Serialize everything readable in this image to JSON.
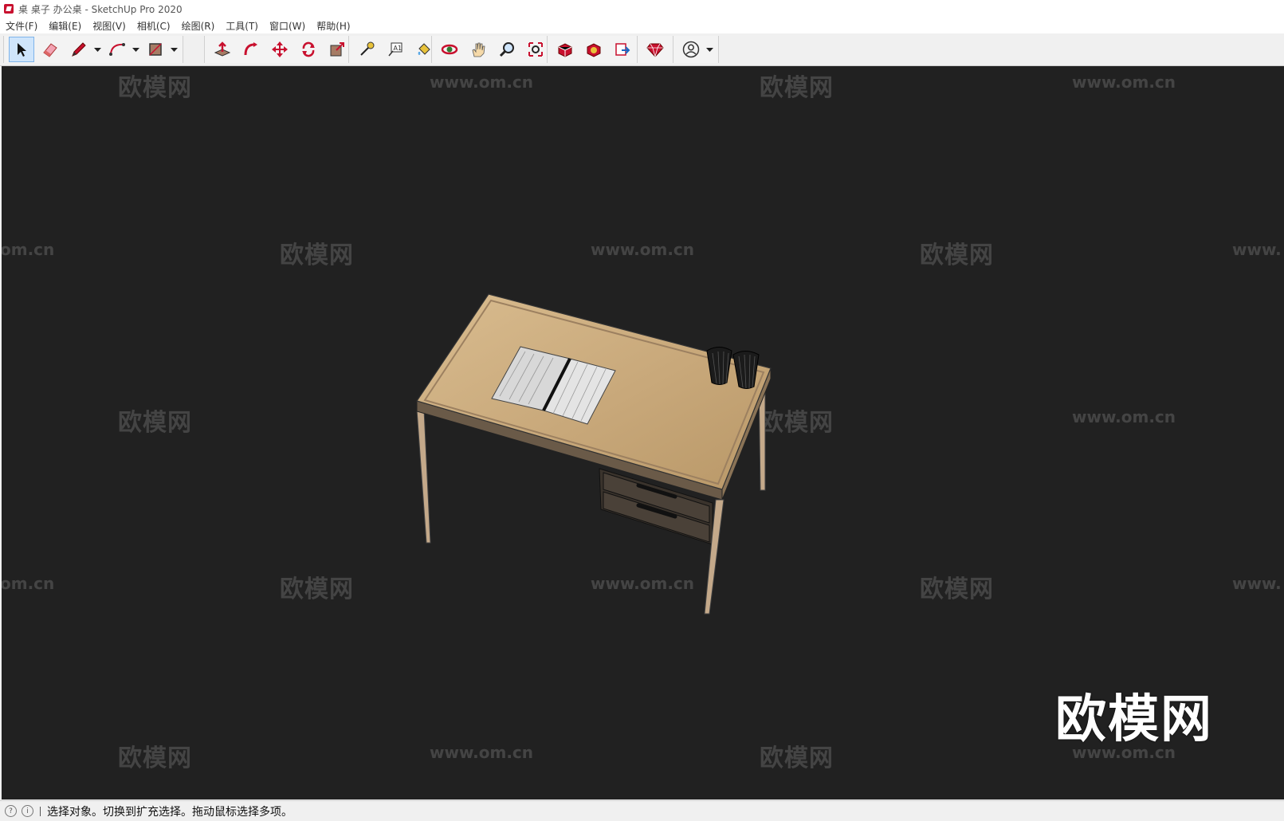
{
  "window": {
    "title": "桌 桌子 办公桌 - SketchUp Pro 2020"
  },
  "menu": {
    "items": [
      "文件(F)",
      "编辑(E)",
      "视图(V)",
      "相机(C)",
      "绘图(R)",
      "工具(T)",
      "窗口(W)",
      "帮助(H)"
    ]
  },
  "toolbar": {
    "active_tool": "select-icon",
    "icons": [
      "select-icon",
      "eraser-icon",
      "pencil-icon",
      "arc-icon",
      "rectangle-icon",
      "push-pull-icon",
      "follow-me-icon",
      "move-icon",
      "rotate-icon",
      "scale-icon",
      "tape-measure-icon",
      "text-icon",
      "paint-bucket-icon",
      "orbit-icon",
      "pan-icon",
      "zoom-icon",
      "zoom-extents-icon",
      "warehouse-icon",
      "extension-warehouse-icon",
      "send-to-layout-icon",
      "ruby-icon",
      "account-icon"
    ]
  },
  "viewport": {
    "background": "#212121",
    "watermark_cn": "欧模网",
    "watermark_url": "www.om.cn",
    "watermark_url_partial_left": "om.cn",
    "watermark_url_partial_right": "www.",
    "brand_logo": "欧模网"
  },
  "status": {
    "message": "选择对象。切换到扩充选择。拖动鼠标选择多项。"
  },
  "colors": {
    "selected_tool_bg": "#cfe5fb",
    "desk_top": "#c9a97c",
    "viewport_bg": "#212121"
  }
}
